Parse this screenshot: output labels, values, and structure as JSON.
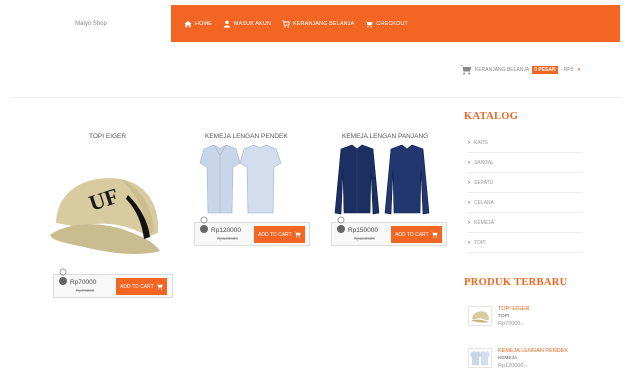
{
  "header": {
    "brand": "Malyn Shop",
    "nav": [
      {
        "label": "HOME",
        "icon": "home-icon"
      },
      {
        "label": "MASUK AKUN",
        "icon": "user-icon"
      },
      {
        "label": "KERANJANG BELANJA",
        "icon": "cart-icon"
      },
      {
        "label": "CHECKOUT",
        "icon": "checkout-cart-icon"
      }
    ]
  },
  "cart": {
    "label": "KERANJANG BELANJA",
    "count": "0 PESAN",
    "total": "- RP0.",
    "chevron": "▾"
  },
  "products": [
    {
      "name": "TOPI EIGER",
      "price": "Rp70000",
      "old_price": "Rp70000",
      "button": "ADD TO CART"
    },
    {
      "name": "KEMEJA LENGAN PENDEK",
      "price": "Rp120000",
      "old_price": "Rp120000",
      "button": "ADD TO CART"
    },
    {
      "name": "KEMEJA LENGAN PANJANG",
      "price": "Rp150000",
      "old_price": "Rp150000",
      "button": "ADD TO CART"
    }
  ],
  "sidebar": {
    "catalog_title": "KATALOG",
    "categories": [
      "KAOS",
      "SANDAL",
      "SEPATU",
      "CELANA",
      "KEMEJA",
      "TOPI"
    ],
    "newest_title": "PRODUK TERBARU",
    "newest": [
      {
        "name": "TOPI EIGER",
        "category": "TOPI",
        "price": "Rp70000,-"
      },
      {
        "name": "KEMEJA LENGAN PENDEK",
        "category": "KEMEJA",
        "price": "Rp120000,-"
      }
    ]
  },
  "colors": {
    "accent": "#f26522",
    "cap": "#d8cba0",
    "shirt_light": "#c9d6ea",
    "shirt_dark": "#1c2f63"
  }
}
